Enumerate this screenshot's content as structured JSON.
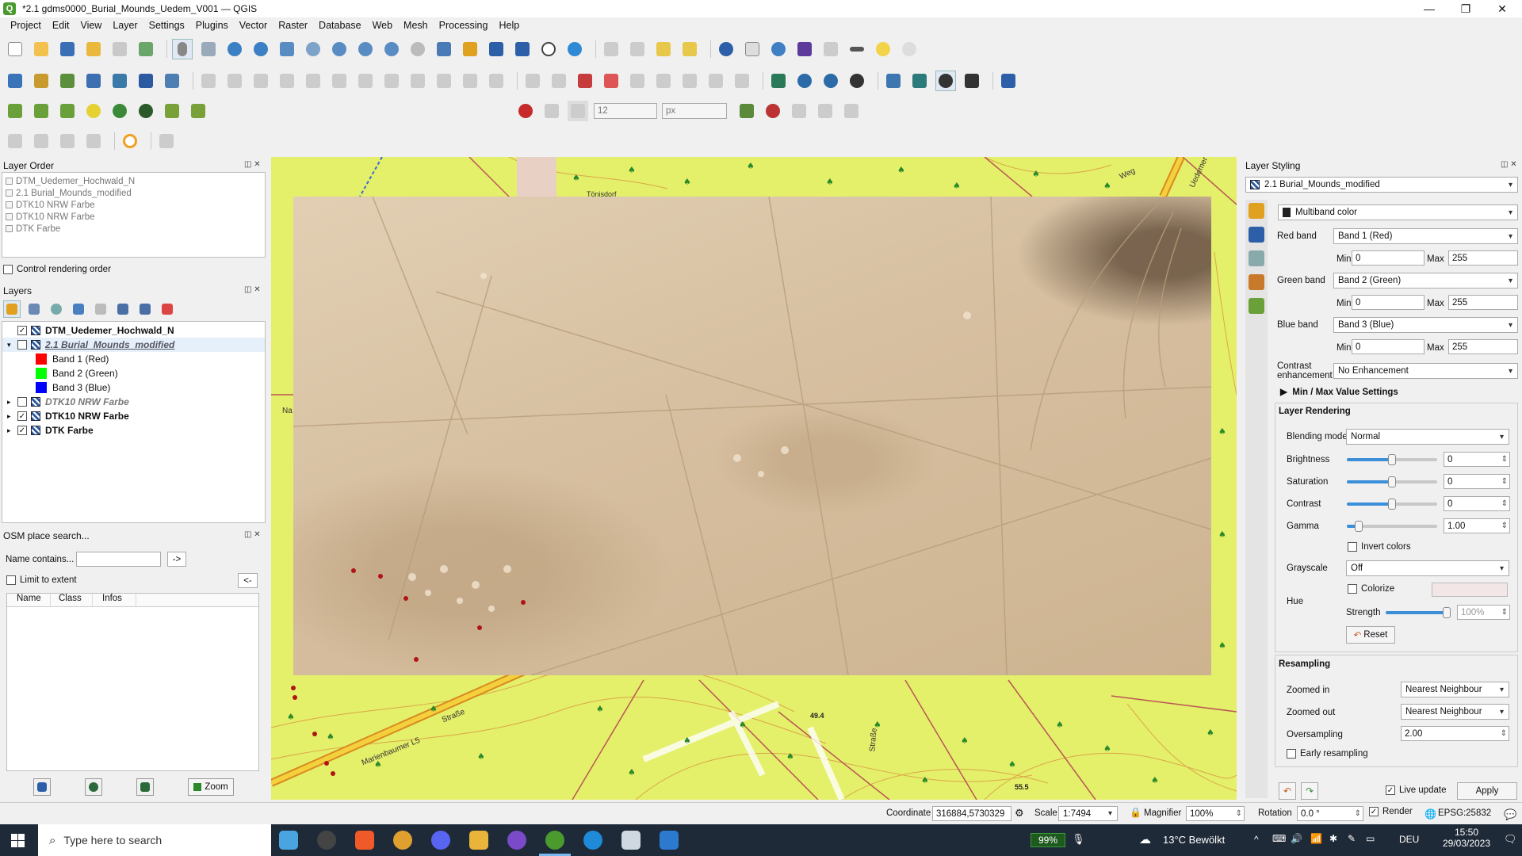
{
  "window": {
    "title": "*2.1 gdms0000_Burial_Mounds_Uedem_V001 — QGIS",
    "min_icon": "—",
    "max_icon": "❐",
    "close_icon": "✕"
  },
  "menu": [
    "Project",
    "Edit",
    "View",
    "Layer",
    "Settings",
    "Plugins",
    "Vector",
    "Raster",
    "Database",
    "Web",
    "Mesh",
    "Processing",
    "Help"
  ],
  "snap": {
    "tolerance": "12",
    "units": "px"
  },
  "layer_order": {
    "title": "Layer Order",
    "items": [
      "DTM_Uedemer_Hochwald_N",
      "2.1 Burial_Mounds_modified",
      "DTK10 NRW Farbe",
      "DTK10 NRW Farbe",
      "DTK Farbe"
    ],
    "control_label": "Control rendering order"
  },
  "layers": {
    "title": "Layers",
    "items": [
      {
        "name": "DTM_Uedemer_Hochwald_N",
        "checked": "✓"
      },
      {
        "name": "2.1 Burial_Mounds_modified",
        "checked": ""
      },
      {
        "name": "Band 1 (Red)",
        "color": "#ff0000"
      },
      {
        "name": "Band 2 (Green)",
        "color": "#00ff00"
      },
      {
        "name": "Band 3 (Blue)",
        "color": "#0000ff"
      },
      {
        "name": "DTK10 NRW Farbe",
        "checked": ""
      },
      {
        "name": "DTK10 NRW Farbe",
        "checked": "✓"
      },
      {
        "name": "DTK Farbe",
        "checked": "✓"
      }
    ]
  },
  "osm": {
    "title": "OSM place search...",
    "name_label": "Name contains...",
    "go": "->",
    "limit_label": "Limit to extent",
    "back": "<-",
    "columns": [
      "Name",
      "Class",
      "Infos"
    ],
    "zoom": "Zoom"
  },
  "map_labels": {
    "street1": "Marienbaumer L5",
    "street2": "Straße",
    "street3": "Straße",
    "weg": "Weg",
    "uedem": "Uedemer",
    "zunder": "Tönisdorf",
    "na": "Na",
    "h1": "49.4",
    "h2": "55.5"
  },
  "styling": {
    "title": "Layer Styling",
    "layer": "2.1 Burial_Mounds_modified",
    "renderer": "Multiband color",
    "red_label": "Red band",
    "red_band": "Band 1 (Red)",
    "green_label": "Green band",
    "green_band": "Band 2 (Green)",
    "blue_label": "Blue band",
    "blue_band": "Band 3 (Blue)",
    "min_label": "Min",
    "max_label": "Max",
    "min_val": "0",
    "max_val": "255",
    "contrast_label1": "Contrast",
    "contrast_label2": "enhancement",
    "contrast_val": "No Enhancement",
    "minmax_label": "Min / Max Value Settings",
    "layer_rendering": "Layer Rendering",
    "blend_label": "Blending mode",
    "blend_val": "Normal",
    "brightness_label": "Brightness",
    "brightness_val": "0",
    "saturation_label": "Saturation",
    "saturation_val": "0",
    "contrast2_label": "Contrast",
    "contrast2_val": "0",
    "gamma_label": "Gamma",
    "gamma_val": "1.00",
    "invert_label": "Invert colors",
    "grayscale_label": "Grayscale",
    "grayscale_val": "Off",
    "colorize_label": "Colorize",
    "hue_label": "Hue",
    "strength_label": "Strength",
    "strength_val": "100%",
    "reset": "Reset",
    "resampling": "Resampling",
    "zin_label": "Zoomed in",
    "zin_val": "Nearest Neighbour",
    "zout_label": "Zoomed out",
    "zout_val": "Nearest Neighbour",
    "over_label": "Oversampling",
    "over_val": "2.00",
    "early_label": "Early resampling",
    "live_label": "Live update",
    "apply": "Apply"
  },
  "status": {
    "coord_label": "Coordinate",
    "coord": "316884,5730329",
    "scale_label": "Scale",
    "scale": "1:7494",
    "mag_label": "Magnifier",
    "mag": "100%",
    "rot_label": "Rotation",
    "rot": "0.0 °",
    "render_label": "Render",
    "crs": "EPSG:25832"
  },
  "taskbar": {
    "search": "Type here to search",
    "battery": "99%",
    "weather": "13°C  Bewölkt",
    "lang": "DEU",
    "time": "15:50",
    "date": "29/03/2023"
  },
  "colors": {
    "map_bg": "#e4ef6a",
    "hillshade": "#d8c2a2",
    "mound_marker": "#b01515",
    "accent": "#3b8fd9"
  }
}
